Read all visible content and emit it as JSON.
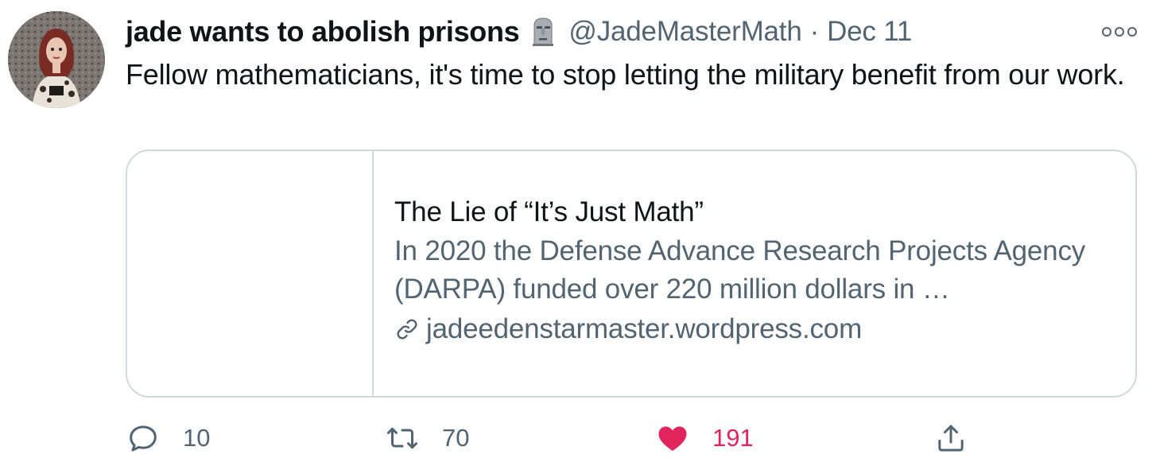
{
  "author": {
    "display_name": "jade wants to abolish prisons",
    "name_emoji": "moai-icon",
    "handle": "@JadeMasterMath",
    "separator": "·",
    "date": "Dec 11"
  },
  "tweet": {
    "text": "Fellow mathematicians, it's time to stop letting the military benefit from our work."
  },
  "link_card": {
    "title": "The Lie of “It’s Just Math”",
    "description": "In 2020 the Defense Advance Research Projects Agency (DARPA) funded over 220 million dollars in …",
    "domain": "jadeedenstarmaster.wordpress.com",
    "domain_icon": "link-icon"
  },
  "actions": {
    "reply": {
      "icon": "reply-icon",
      "count": "10"
    },
    "retweet": {
      "icon": "retweet-icon",
      "count": "70"
    },
    "like": {
      "icon": "heart-icon",
      "count": "191",
      "liked": true
    },
    "share": {
      "icon": "share-icon"
    }
  },
  "colors": {
    "text_primary": "#0f1419",
    "text_secondary": "#536471",
    "border": "#cfd9de",
    "like_active": "#e0245e"
  }
}
